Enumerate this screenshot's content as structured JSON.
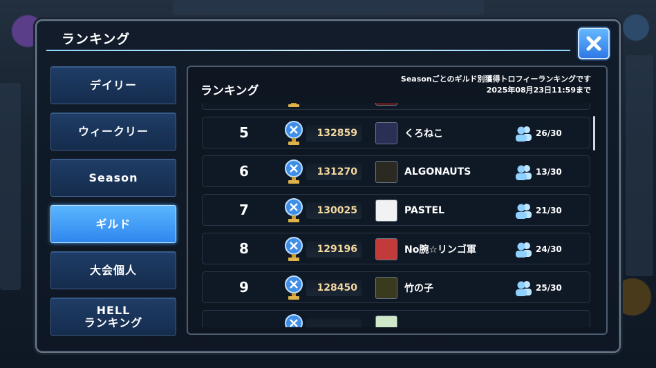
{
  "dialog": {
    "title": "ランキング"
  },
  "side_menu": {
    "items": [
      {
        "label": "デイリー",
        "active": false
      },
      {
        "label": "ウィークリー",
        "active": false
      },
      {
        "label": "Season",
        "active": false
      },
      {
        "label": "ギルド",
        "active": true
      },
      {
        "label": "大会個人",
        "active": false
      },
      {
        "label": "HELL\nランキング",
        "active": false
      }
    ]
  },
  "panel": {
    "title": "ランキング",
    "description_line1": "Seasonごとのギルド別獲得トロフィーランキングです",
    "description_line2": "2025年08月23日11:59まで"
  },
  "rows": [
    {
      "rank": "5",
      "score": "132859",
      "name": "くろねこ",
      "members": "26/30",
      "emblem_color": "#2b2f55"
    },
    {
      "rank": "6",
      "score": "131270",
      "name": "ALGONAUTS",
      "members": "13/30",
      "emblem_color": "#2a2a22"
    },
    {
      "rank": "7",
      "score": "130025",
      "name": "PASTEL",
      "members": "21/30",
      "emblem_color": "#f2f2f2"
    },
    {
      "rank": "8",
      "score": "129196",
      "name": "No腕☆リンゴ軍",
      "members": "24/30",
      "emblem_color": "#c23a3a"
    },
    {
      "rank": "9",
      "score": "128450",
      "name": "竹の子",
      "members": "25/30",
      "emblem_color": "#3a3a1e"
    }
  ],
  "colors": {
    "accent_blue": "#2f86ee",
    "score_text": "#f4d9a0",
    "member_icon": "#8fd0ff"
  },
  "icons": {
    "close": "close-icon",
    "trophy": "trophy-icon",
    "members": "members-icon"
  }
}
